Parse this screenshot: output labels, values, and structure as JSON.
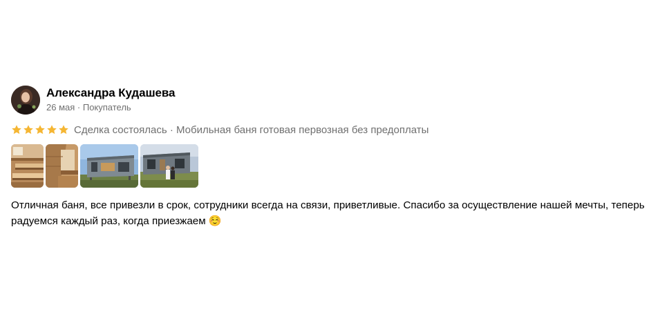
{
  "review": {
    "author_name": "Александра Кудашева",
    "date": "26 мая",
    "separator": " · ",
    "role": "Покупатель",
    "rating": 5,
    "rating_max": 5,
    "star_color": "#f5b633",
    "deal_status": "Сделка состоялась",
    "product": "Мобильная баня готовая первозная без предоплаты",
    "photos": [
      {
        "icon": "sauna-interior-photo"
      },
      {
        "icon": "sauna-interior-photo"
      },
      {
        "icon": "mobile-sauna-exterior-photo"
      },
      {
        "icon": "mobile-sauna-exterior-people-photo"
      }
    ],
    "text": "Отличная баня, все привезли в срок, сотрудники всегда на связи, приветливые. Спасибо за осуществление нашей мечты, теперь радуемся каждый раз, когда приезжаем ☺️"
  }
}
